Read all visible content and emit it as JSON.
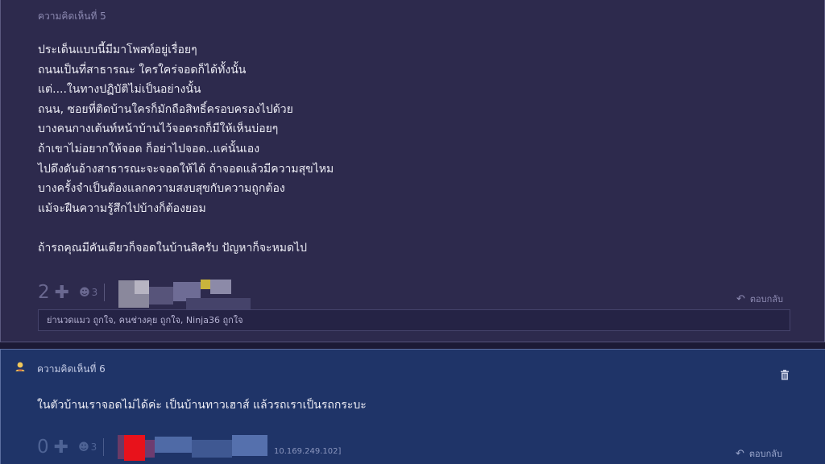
{
  "comment5": {
    "header": "ความคิดเห็นที่ 5",
    "lines": [
      "ประเด็นแบบนี้มีมาโพสท์อยู่เรื่อยๆ",
      "ถนนเป็นที่สาธารณะ ใครใคร่จอดก็ได้ทั้งนั้น",
      "แต่....ในทางปฏิบัติไม่เป็นอย่างนั้น",
      "ถนน, ซอยที่ติดบ้านใครก็มักถือสิทธิ์ครอบครองไปด้วย",
      "บางคนกางเต้นท์หน้าบ้านไว้จอดรถก็มีให้เห็นบ่อยๆ",
      "ถ้าเขาไม่อยากให้จอด ก็อย่าไปจอด..แค่นั้นเอง",
      "ไปดึงดันอ้างสาธารณะจะจอดให้ได้ ถ้าจอดแล้วมีความสุขไหม",
      "บางครั้งจำเป็นต้องแลกความสงบสุขกับความถูกต้อง",
      "แม้จะฝืนความรู้สึกไปบ้างก็ต้องยอม"
    ],
    "last_line": "ถ้ารถคุณมีคันเดียวก็จอดในบ้านสิครับ ปัญหาก็จะหมดไป",
    "vote_count": "2",
    "emotion_count": "3",
    "reply_label": "ตอบกลับ",
    "likes_text": "ย่านวดแมว ถูกใจ, คนช่างคุย ถูกใจ, Ninja36 ถูกใจ"
  },
  "comment6": {
    "header": "ความคิดเห็นที่ 6",
    "text": "ในตัวบ้านเราจอดไม่ได้ค่ะ เป็นบ้านทาวเฮาส์ แล้วรถเราเป็นรถกระบะ",
    "vote_count": "0",
    "emotion_count": "3",
    "ip_fragment": "10.169.249.102]",
    "reply_label": "ตอบกลับ"
  },
  "icons": {
    "plus": "plus-icon",
    "emotion": "emotion-icon",
    "reply": "reply-arrow-icon",
    "delete": "trash-icon",
    "user": "user-badge-icon"
  },
  "colors": {
    "comment5_bg": "#2d2a4d",
    "comment6_bg": "#1f3468",
    "text": "#ececf4",
    "muted": "#8e8bb3"
  }
}
